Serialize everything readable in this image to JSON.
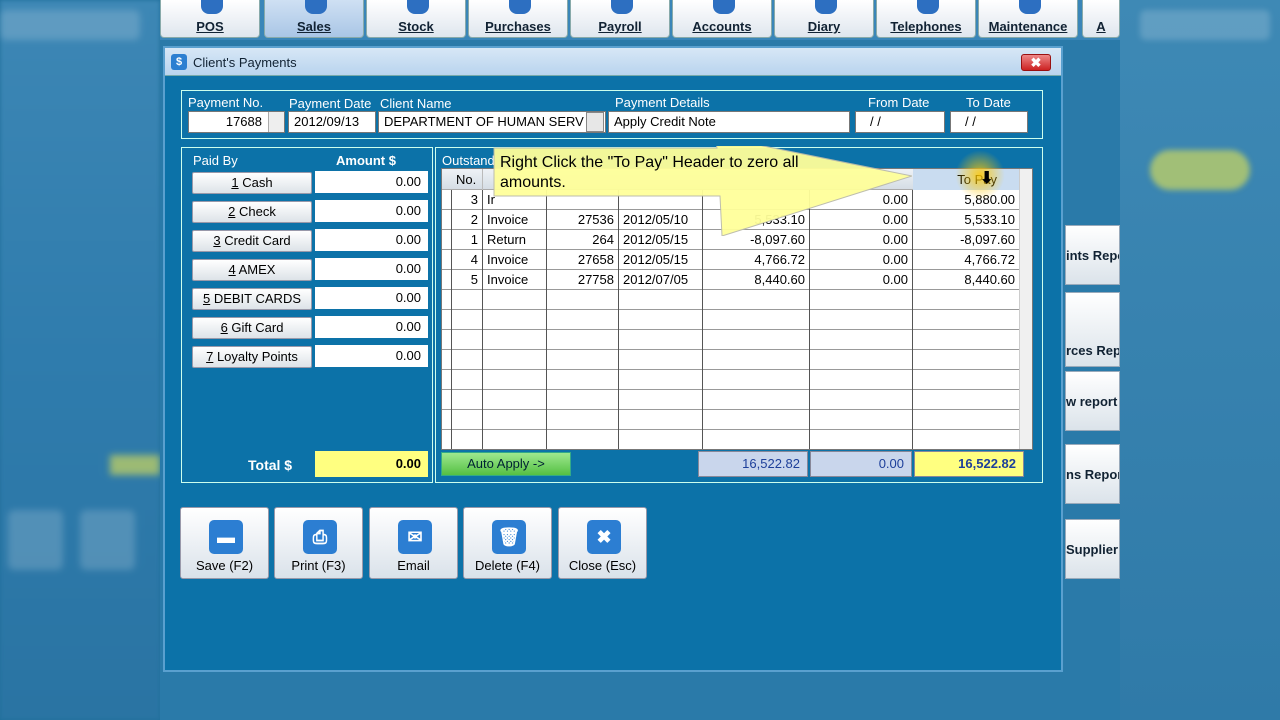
{
  "toolbar": {
    "items": [
      {
        "label": "POS"
      },
      {
        "label": "Sales"
      },
      {
        "label": "Stock"
      },
      {
        "label": "Purchases"
      },
      {
        "label": "Payroll"
      },
      {
        "label": "Accounts"
      },
      {
        "label": "Diary"
      },
      {
        "label": "Telephones"
      },
      {
        "label": "Maintenance"
      },
      {
        "label": "A"
      }
    ],
    "selected": "Sales"
  },
  "right_side": {
    "items": [
      {
        "label": "ints Repo"
      },
      {
        "label": "rces Repo"
      },
      {
        "label": "w report"
      },
      {
        "label": "ns Repor"
      },
      {
        "label": "Supplier"
      }
    ]
  },
  "dialog": {
    "title": "Client's Payments",
    "close_glyph": "✖",
    "icon_glyph": "$",
    "header": {
      "payment_no_label": "Payment No.",
      "payment_no_value": "17688",
      "payment_date_label": "Payment Date",
      "payment_date_value": "2012/09/13",
      "client_name_label": "Client Name",
      "client_name_value": "DEPARTMENT OF HUMAN SERV",
      "payment_details_label": "Payment Details",
      "payment_details_value": "Apply Credit Note",
      "from_date_label": "From Date",
      "from_date_value": " / /",
      "to_date_label": "To Date",
      "to_date_value": " / /"
    },
    "paid_by": {
      "heading": "Paid By",
      "amount_heading": "Amount $",
      "methods": [
        {
          "key": "1",
          "label": " Cash",
          "amount": "0.00"
        },
        {
          "key": "2",
          "label": " Check",
          "amount": "0.00"
        },
        {
          "key": "3",
          "label": " Credit Card",
          "amount": "0.00"
        },
        {
          "key": "4",
          "label": " AMEX",
          "amount": "0.00"
        },
        {
          "key": "5",
          "label": " DEBIT CARDS",
          "amount": "0.00"
        },
        {
          "key": "6",
          "label": " Gift Card",
          "amount": "0.00"
        },
        {
          "key": "7",
          "label": " Loyalty Points",
          "amount": "0.00"
        }
      ],
      "total_label": "Total $",
      "total_value": "0.00"
    },
    "outstanding": {
      "heading": "Outstand",
      "columns": {
        "no": "No.",
        "to_pay": "To Pay"
      },
      "rows": [
        {
          "no": "3",
          "type": "Ir",
          "ref": "",
          "date": "",
          "amount": "",
          "paid": "0.00",
          "to_pay": "5,880.00"
        },
        {
          "no": "2",
          "type": "Invoice",
          "ref": "27536",
          "date": "2012/05/10",
          "amount": "5,533.10",
          "paid": "0.00",
          "to_pay": "5,533.10"
        },
        {
          "no": "1",
          "type": "Return",
          "ref": "264",
          "date": "2012/05/15",
          "amount": "-8,097.60",
          "paid": "0.00",
          "to_pay": "-8,097.60"
        },
        {
          "no": "4",
          "type": "Invoice",
          "ref": "27658",
          "date": "2012/05/15",
          "amount": "4,766.72",
          "paid": "0.00",
          "to_pay": "4,766.72"
        },
        {
          "no": "5",
          "type": "Invoice",
          "ref": "27758",
          "date": "2012/07/05",
          "amount": "8,440.60",
          "paid": "0.00",
          "to_pay": "8,440.60"
        }
      ],
      "auto_apply_label": "Auto Apply ->",
      "total_amount": "16,522.82",
      "total_paid": "0.00",
      "total_to_pay": "16,522.82"
    },
    "actions": [
      {
        "key": "save",
        "label": "Save (F2)",
        "glyph": "▬"
      },
      {
        "key": "print",
        "label": "Print (F3)",
        "glyph": "⎙"
      },
      {
        "key": "email",
        "label": "Email",
        "glyph": "✉"
      },
      {
        "key": "delete",
        "label": "Delete (F4)",
        "glyph": "🗑"
      },
      {
        "key": "close",
        "label": "Close (Esc)",
        "glyph": "✖"
      }
    ]
  },
  "tooltip": {
    "text": "Right Click the \"To Pay\" Header to zero all amounts."
  },
  "colors": {
    "dialog_bg": "#0c72a8",
    "total_highlight": "#ffff80",
    "auto_apply": "#55c043",
    "tooltip": "#ffff9a"
  }
}
